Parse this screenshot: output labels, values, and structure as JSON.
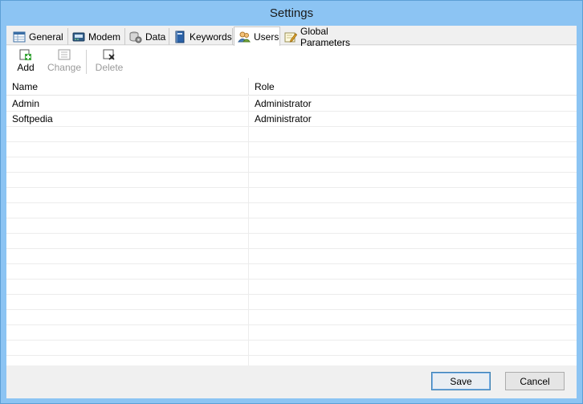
{
  "window": {
    "title": "Settings"
  },
  "tabs": [
    {
      "label": "General",
      "icon": "table-icon"
    },
    {
      "label": "Modem",
      "icon": "modem-icon"
    },
    {
      "label": "Data",
      "icon": "gear-db-icon"
    },
    {
      "label": "Keywords",
      "icon": "book-icon"
    },
    {
      "label": "Users",
      "icon": "users-icon",
      "active": true
    },
    {
      "label": "Global Parameters",
      "icon": "note-pencil-icon"
    }
  ],
  "toolbar": {
    "add_label": "Add",
    "change_label": "Change",
    "delete_label": "Delete"
  },
  "grid": {
    "columns": [
      "Name",
      "Role"
    ],
    "rows": [
      [
        "Admin",
        "Administrator"
      ],
      [
        "Softpedia",
        "Administrator"
      ]
    ]
  },
  "footer": {
    "save_label": "Save",
    "cancel_label": "Cancel"
  },
  "colors": {
    "titlebar": "#8cc4f3",
    "client": "#f0f0f0",
    "accent_border": "#3c7fb1"
  }
}
